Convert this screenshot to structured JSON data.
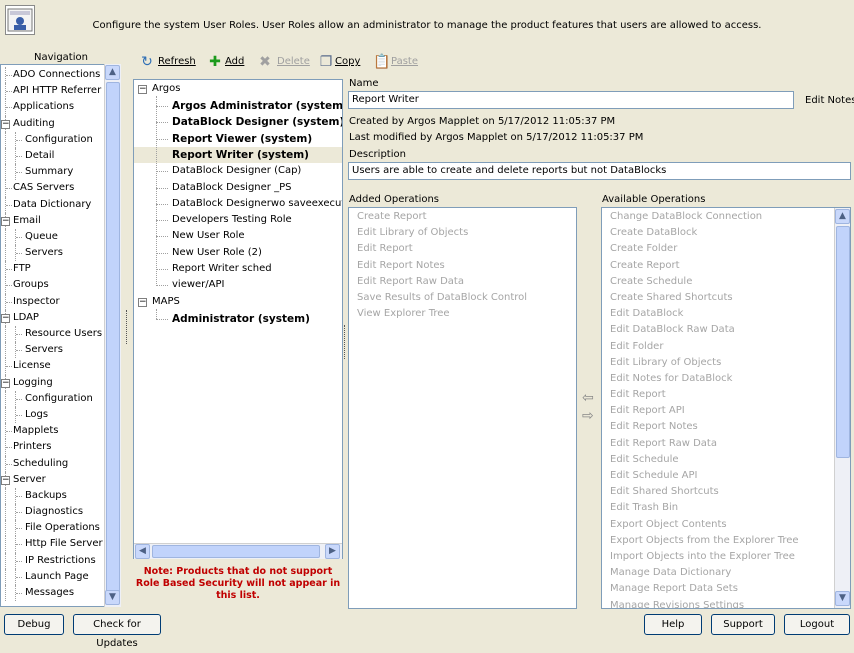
{
  "header": {
    "description": "Configure the system User Roles.  User Roles allow an administrator to manage the product features that users are allowed to access."
  },
  "nav": {
    "title": "Navigation",
    "items": [
      {
        "label": "ADO Connections",
        "level": 0
      },
      {
        "label": "API HTTP Referrer",
        "level": 0
      },
      {
        "label": "Applications",
        "level": 0
      },
      {
        "label": "Auditing",
        "level": 0,
        "expander": "−"
      },
      {
        "label": "Configuration",
        "level": 1
      },
      {
        "label": "Detail",
        "level": 1
      },
      {
        "label": "Summary",
        "level": 1
      },
      {
        "label": "CAS Servers",
        "level": 0
      },
      {
        "label": "Data Dictionary",
        "level": 0
      },
      {
        "label": "Email",
        "level": 0,
        "expander": "−"
      },
      {
        "label": "Queue",
        "level": 1
      },
      {
        "label": "Servers",
        "level": 1
      },
      {
        "label": "FTP",
        "level": 0
      },
      {
        "label": "Groups",
        "level": 0
      },
      {
        "label": "Inspector",
        "level": 0
      },
      {
        "label": "LDAP",
        "level": 0,
        "expander": "−"
      },
      {
        "label": "Resource Users",
        "level": 1
      },
      {
        "label": "Servers",
        "level": 1
      },
      {
        "label": "License",
        "level": 0
      },
      {
        "label": "Logging",
        "level": 0,
        "expander": "−"
      },
      {
        "label": "Configuration",
        "level": 1
      },
      {
        "label": "Logs",
        "level": 1
      },
      {
        "label": "Mapplets",
        "level": 0
      },
      {
        "label": "Printers",
        "level": 0
      },
      {
        "label": "Scheduling",
        "level": 0
      },
      {
        "label": "Server",
        "level": 0,
        "expander": "−"
      },
      {
        "label": "Backups",
        "level": 1
      },
      {
        "label": "Diagnostics",
        "level": 1
      },
      {
        "label": "File Operations",
        "level": 1
      },
      {
        "label": "Http File Server",
        "level": 1
      },
      {
        "label": "IP Restrictions",
        "level": 1
      },
      {
        "label": "Launch Page",
        "level": 1
      },
      {
        "label": "Messages",
        "level": 1
      }
    ]
  },
  "toolbar": {
    "refresh": "Refresh",
    "add": "Add",
    "delete": "Delete",
    "copy": "Copy",
    "paste": "Paste"
  },
  "roles": {
    "groups": [
      {
        "label": "Argos",
        "items": [
          {
            "label": "Argos Administrator (system)",
            "bold": true
          },
          {
            "label": "DataBlock Designer (system)",
            "bold": true
          },
          {
            "label": "Report Viewer (system)",
            "bold": true
          },
          {
            "label": "Report Writer (system)",
            "bold": true,
            "selected": true
          },
          {
            "label": "DataBlock Designer (Cap)",
            "bold": false
          },
          {
            "label": "DataBlock Designer _PS",
            "bold": false
          },
          {
            "label": "DataBlock Designerwo saveexecution s",
            "bold": false
          },
          {
            "label": "Developers Testing Role",
            "bold": false
          },
          {
            "label": "New User Role",
            "bold": false
          },
          {
            "label": "New User Role (2)",
            "bold": false
          },
          {
            "label": "Report Writer sched",
            "bold": false
          },
          {
            "label": "viewer/API",
            "bold": false
          }
        ]
      },
      {
        "label": "MAPS",
        "items": [
          {
            "label": "Administrator (system)",
            "bold": true
          }
        ]
      }
    ],
    "note": "Note: Products that do not support Role Based Security will not appear in this list."
  },
  "details": {
    "name_label": "Name",
    "name_value": "Report Writer",
    "edit_notes": "Edit Notes",
    "created": "Created by Argos Mapplet on 5/17/2012 11:05:37 PM",
    "modified": "Last modified by Argos Mapplet on 5/17/2012 11:05:37 PM",
    "description_label": "Description",
    "description_value": "Users are able to create and delete reports but not DataBlocks",
    "added_label": "Added Operations",
    "added_ops": [
      "Create Report",
      "Edit Library of Objects",
      "Edit Report",
      "Edit Report Notes",
      "Edit Report Raw Data",
      "Save Results of DataBlock Control",
      "View Explorer Tree"
    ],
    "available_label": "Available Operations",
    "available_ops": [
      "Change DataBlock Connection",
      "Create DataBlock",
      "Create Folder",
      "Create Report",
      "Create Schedule",
      "Create Shared Shortcuts",
      "Edit DataBlock",
      "Edit DataBlock Raw Data",
      "Edit Folder",
      "Edit Library of Objects",
      "Edit Notes for DataBlock",
      "Edit Report",
      "Edit Report API",
      "Edit Report Notes",
      "Edit Report Raw Data",
      "Edit Schedule",
      "Edit Schedule API",
      "Edit Shared Shortcuts",
      "Edit Trash Bin",
      "Export Object Contents",
      "Export Objects from the Explorer Tree",
      "Import Objects into the Explorer Tree",
      "Manage Data Dictionary",
      "Manage Report Data Sets",
      "Manage Revisions Settings"
    ]
  },
  "buttons": {
    "debug": "Debug",
    "check_updates": "Check for Updates",
    "help": "Help",
    "support": "Support",
    "logout": "Logout"
  },
  "colors": {
    "background": "#ece9d8",
    "border": "#7f9db9",
    "note": "#c00000",
    "disabled": "#a5a5a5"
  }
}
